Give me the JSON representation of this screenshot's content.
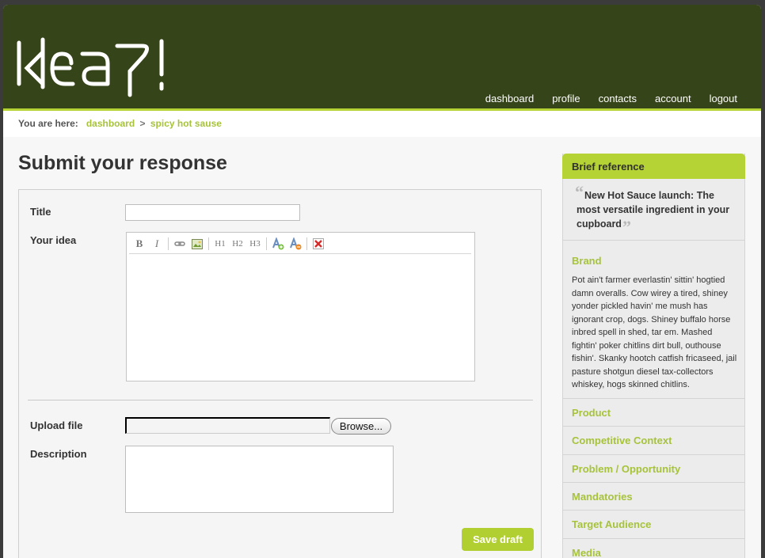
{
  "app": {
    "logo_text": "idea?!"
  },
  "nav": {
    "items": [
      "dashboard",
      "profile",
      "contacts",
      "account",
      "logout"
    ]
  },
  "breadcrumb": {
    "label": "You are here:",
    "items": [
      "dashboard",
      "spicy hot sause"
    ],
    "separator": ">"
  },
  "page": {
    "title": "Submit your response"
  },
  "form": {
    "title_label": "Title",
    "title_value": "",
    "idea_label": "Your idea",
    "toolbar": {
      "bold": "B",
      "italic": "I",
      "h1": "H1",
      "h2": "H2",
      "h3": "H3"
    },
    "upload_label": "Upload file",
    "browse_label": "Browse...",
    "description_label": "Description",
    "save_label": "Save draft"
  },
  "sidebar": {
    "header": "Brief reference",
    "quote": "New Hot Sauce launch: The most versatile ingredient in your cupboard",
    "brand_title": "Brand",
    "brand_text": "Pot ain't farmer everlastin' sittin' hogtied damn overalls. Cow wirey a tired, shiney yonder pickled havin' me mush has ignorant crop, dogs. Shiney buffalo horse inbred spell in shed, tar em. Mashed fightin' poker chitlins dirt bull, outhouse fishin'. Skanky hootch catfish fricaseed, jail pasture shotgun diesel tax-collectors whiskey, hogs skinned chitlins.",
    "sections": [
      "Product",
      "Competitive Context",
      "Problem / Opportunity",
      "Mandatories",
      "Target Audience",
      "Media"
    ]
  },
  "colors": {
    "header_bg": "#36441a",
    "accent": "#b5d334",
    "link": "#a6c33a"
  }
}
